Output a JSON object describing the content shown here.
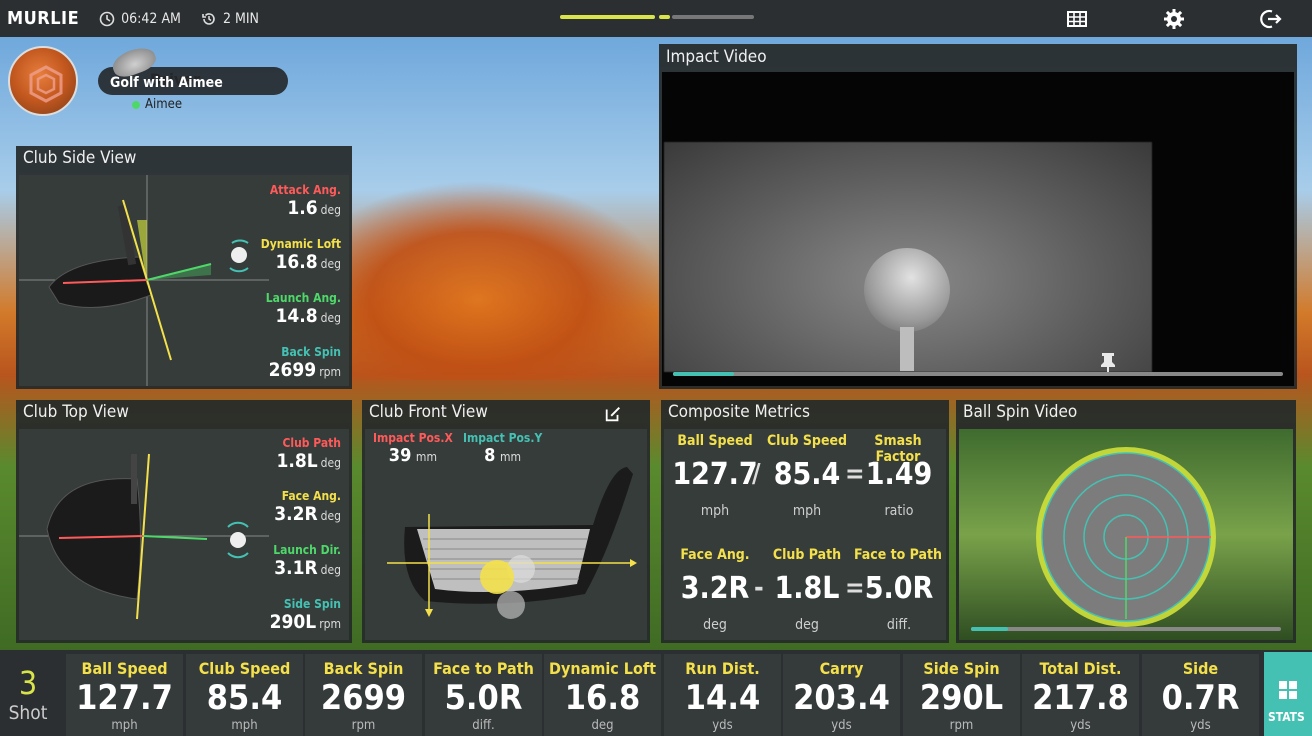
{
  "topbar": {
    "brand": "MURLIE",
    "time": "06:42 AM",
    "duration": "2 MIN"
  },
  "player": {
    "club": "Driver",
    "mode": "Golf with Aimee",
    "name": "Aimee"
  },
  "side_view": {
    "title": "Club Side View",
    "metrics": [
      {
        "label": "Attack Ang.",
        "value": "1.6",
        "unit": "deg",
        "color": "#ff5a5a"
      },
      {
        "label": "Dynamic Loft",
        "value": "16.8",
        "unit": "deg",
        "color": "#f3e04a"
      },
      {
        "label": "Launch Ang.",
        "value": "14.8",
        "unit": "deg",
        "color": "#4fd86a"
      },
      {
        "label": "Back Spin",
        "value": "2699",
        "unit": "rpm",
        "color": "#45c1b3"
      }
    ]
  },
  "top_view": {
    "title": "Club Top View",
    "metrics": [
      {
        "label": "Club Path",
        "value": "1.8L",
        "unit": "deg",
        "color": "#ff5a5a"
      },
      {
        "label": "Face Ang.",
        "value": "3.2R",
        "unit": "deg",
        "color": "#f3e04a"
      },
      {
        "label": "Launch Dir.",
        "value": "3.1R",
        "unit": "deg",
        "color": "#4fd86a"
      },
      {
        "label": "Side Spin",
        "value": "290L",
        "unit": "rpm",
        "color": "#45c1b3"
      }
    ]
  },
  "front_view": {
    "title": "Club Front View",
    "pos_x_label": "Impact Pos.X",
    "pos_x_value": "39",
    "pos_x_unit": "mm",
    "pos_y_label": "Impact Pos.Y",
    "pos_y_value": "8",
    "pos_y_unit": "mm"
  },
  "composite": {
    "title": "Composite Metrics",
    "row1": [
      {
        "label": "Ball Speed",
        "value": "127.7",
        "unit": "mph"
      },
      {
        "label": "Club Speed",
        "value": "85.4",
        "unit": "mph"
      },
      {
        "label": "Smash Factor",
        "value": "1.49",
        "unit": "ratio"
      }
    ],
    "row2": [
      {
        "label": "Face Ang.",
        "value": "3.2R",
        "unit": "deg"
      },
      {
        "label": "Club Path",
        "value": "1.8L",
        "unit": "deg"
      },
      {
        "label": "Face to Path",
        "value": "5.0R",
        "unit": "diff."
      }
    ],
    "ops": [
      "/",
      "=",
      "-",
      "="
    ]
  },
  "impact_video": {
    "title": "Impact Video",
    "progress": 0.1
  },
  "spin_video": {
    "title": "Ball Spin Video",
    "progress": 0.12
  },
  "bottom": {
    "shot_number": "3",
    "shot_label": "Shot",
    "stats": [
      {
        "label": "Ball Speed",
        "value": "127.7",
        "unit": "mph"
      },
      {
        "label": "Club Speed",
        "value": "85.4",
        "unit": "mph"
      },
      {
        "label": "Back Spin",
        "value": "2699",
        "unit": "rpm"
      },
      {
        "label": "Face to Path",
        "value": "5.0R",
        "unit": "diff."
      },
      {
        "label": "Dynamic Loft",
        "value": "16.8",
        "unit": "deg"
      },
      {
        "label": "Run Dist.",
        "value": "14.4",
        "unit": "yds"
      },
      {
        "label": "Carry",
        "value": "203.4",
        "unit": "yds"
      },
      {
        "label": "Side Spin",
        "value": "290L",
        "unit": "rpm"
      },
      {
        "label": "Total Dist.",
        "value": "217.8",
        "unit": "yds"
      },
      {
        "label": "Side",
        "value": "0.7R",
        "unit": "yds"
      }
    ],
    "stats_button": "STATS"
  },
  "colors": {
    "accent_yellow": "#d9e44a",
    "teal": "#45c1b3",
    "red": "#ff5a5a",
    "green": "#4fd86a"
  }
}
